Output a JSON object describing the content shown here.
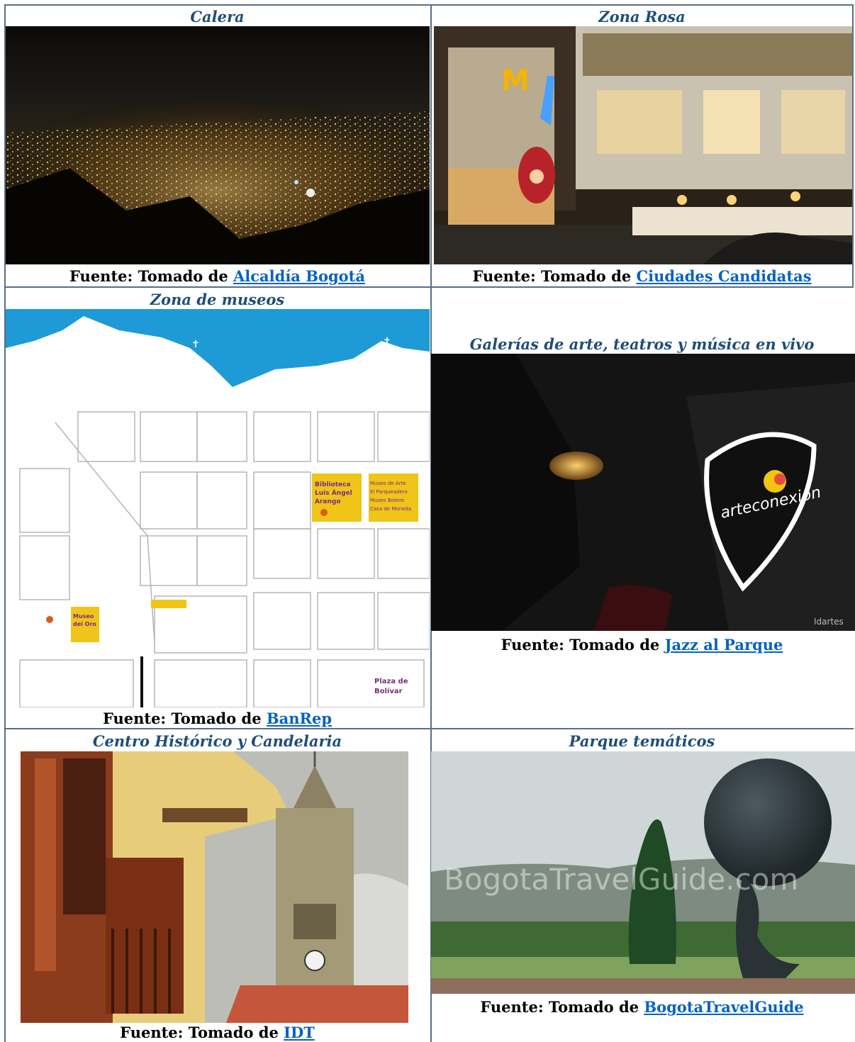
{
  "cells": {
    "calera": {
      "caption": "Calera",
      "source_prefix": "Fuente: Tomado de",
      "link": "Alcaldía Bogotá"
    },
    "zona_rosa": {
      "caption": "Zona Rosa",
      "source_prefix": "Fuente: Tomado de",
      "link": "Ciudades Candidatas",
      "sign_text": "M"
    },
    "museos": {
      "caption": "Zona de museos",
      "source_prefix": "Fuente: Tomado de",
      "link": "BanRep",
      "map_labels": {
        "biblioteca": [
          "Biblioteca",
          "Luis Ángel",
          "Arango"
        ],
        "museo_arte": [
          "Museo de Arte",
          "El Parqueadero",
          "Museo Botero",
          "Casa de Moneda"
        ],
        "museo_oro": [
          "Museo",
          "del Oro"
        ],
        "plaza": [
          "Plaza de",
          "Bolívar"
        ]
      }
    },
    "galerias": {
      "caption": "Galerías de arte, teatros y música en vivo",
      "source_prefix": "Fuente: Tomado de",
      "link": "Jazz al Parque",
      "logo_text": "arteconexión",
      "watermark": "Idartes"
    },
    "centro": {
      "caption": "Centro Histórico y Candelaria",
      "source_prefix": "Fuente: Tomado de",
      "link": "IDT"
    },
    "parques": {
      "caption": "Parque temáticos",
      "source_prefix": "Fuente: Tomado de",
      "link": "BogotaTravelGuide",
      "watermark": "BogotaTravelGuide.com"
    }
  },
  "colors": {
    "caption": "#1f4e79",
    "link": "#0563c1",
    "border": "#5b6e86",
    "map_sky": "#1e9ad6",
    "map_block": "#f0c419"
  }
}
